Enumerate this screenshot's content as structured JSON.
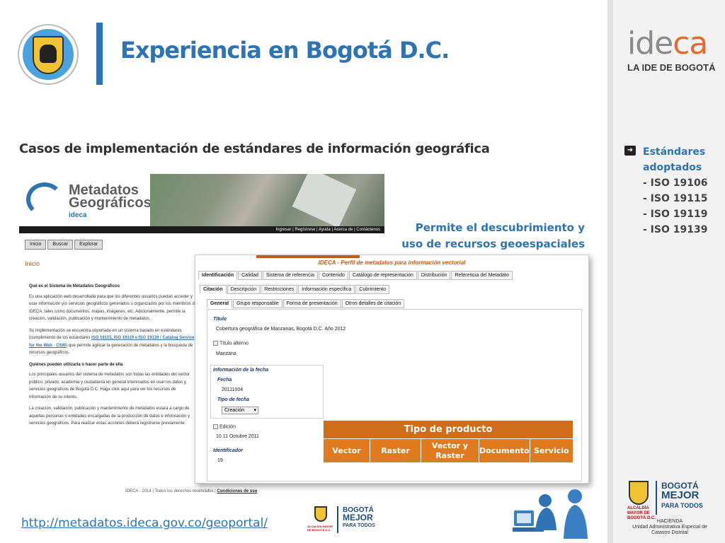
{
  "header": {
    "title": "Experiencia en Bogotá D.C."
  },
  "subtitle": "Casos de implementación de estándares de información geográfica",
  "sidebar": {
    "logo_text_gray": "ide",
    "logo_text_orange": "ca",
    "logo_tagline": "LA IDE DE BOGOTÁ",
    "bullet_title_1": "Estándares",
    "bullet_title_2": "adoptados",
    "standards": [
      "- ISO 19106",
      "- ISO 19115",
      "- ISO 19119",
      "- ISO 19139"
    ],
    "footer_logo": {
      "alcaldia": "ALCALDÍA MAYOR DE BOGOTÁ D.C.",
      "bogota_1": "BOGOTÁ",
      "bogota_2": "MEJOR",
      "bogota_3": "PARA TODOS",
      "hacienda": "HACIENDA",
      "unidad": "Unidad Administrativa Especial de Catastro Distrital"
    }
  },
  "portal": {
    "brand_1": "Metadatos",
    "brand_2": "Geográficos",
    "brand_3": "ideca",
    "topnav": "Ingresar | Regístrese | Ayuda | Acerca de | Contáctenos",
    "tabs": [
      "Inicio",
      "Buscar",
      "Explorar"
    ],
    "page_label": "Inicio",
    "heading_1": "Qué es el Sistema de Metadatos Geográficos",
    "para_1": "Es una aplicación web desarrollada para que los diferentes usuarios puedan acceder y usar información y/o servicios geográficos generados u organizados por los miembros de IDECA, tales como documentos, mapas, imágenes, etc. Adicionalmente, permite la creación, validación, publicación y mantenimiento de metadatos.",
    "para_2_a": "Su implementación se encuentra soportada en un sistema basado en estándares (cumplimiento de los estándares ",
    "para_2_link": "ISO 19115, ISO 19119 e ISO 19139 / Catalog Service for the Web - CSW",
    "para_2_b": ") que permite agilizar la generación de metadatos y la búsqueda de recursos geográficos.",
    "heading_2": "Quiénes pueden utilizarla o hacer parte de ella",
    "para_3": "Los principales usuarios del sistema de metadatos son todas las entidades del sector público, privado, academia y ciudadanía en general interesados en usar los datos y servicios geográficos de Bogotá D.C. Haga click aquí para ver los recursos de información de su interés.",
    "para_4": "La creación, validación, publicación y mantenimiento de metadatos estará a cargo de aquellas personas o entidades encargadas de la producción de datos e información y servicios geográficos. Para realizar estas acciones deberá registrarse previamente.",
    "footer_a": "IDECA - 2014 | Todos los derechos reservados | ",
    "footer_b": "Condiciones de uso"
  },
  "form": {
    "title": "IDECA - Perfil de metadatos para información vectorial",
    "tabs_1": [
      "Identificación",
      "Calidad",
      "Sistema de referencia",
      "Contenido",
      "Catálogo de representación",
      "Distribución",
      "Referencia del Metadato"
    ],
    "tabs_2": [
      "Citación",
      "Descripción",
      "Restricciones",
      "Información específica",
      "Cubrimiento"
    ],
    "tabs_3": [
      "General",
      "Grupo responsable",
      "Forma de presentación",
      "Otros detalles de citación"
    ],
    "titulo_label": "Título",
    "titulo_value": "Cobertura geográfica de Manzanas, Bogotá D.C. Año 2012",
    "titulo_alterno_label": "Título alterno",
    "titulo_alterno_value": "Manzana",
    "info_fecha_label": "Información de la fecha",
    "fecha_label": "Fecha",
    "fecha_value": "20111004",
    "tipo_fecha_label": "Tipo de fecha",
    "tipo_fecha_value": "Creación",
    "edicion_label": "Edición",
    "edicion_value": "10.11 Octubre 2011",
    "identificador_label": "Identificador",
    "identificador_value": "19"
  },
  "product_table": {
    "header": "Tipo de producto",
    "cells": [
      "Vector",
      "Raster",
      "Vector y Raster",
      "Documento",
      "Servicio"
    ]
  },
  "permite_line_1": "Permite el descubrimiento y",
  "permite_line_2": "uso de recursos geoespaciales",
  "url": "http://metadatos.ideca.gov.co/geoportal/",
  "colors": {
    "accent_blue": "#2e74b5",
    "orange": "#e07a1f"
  }
}
